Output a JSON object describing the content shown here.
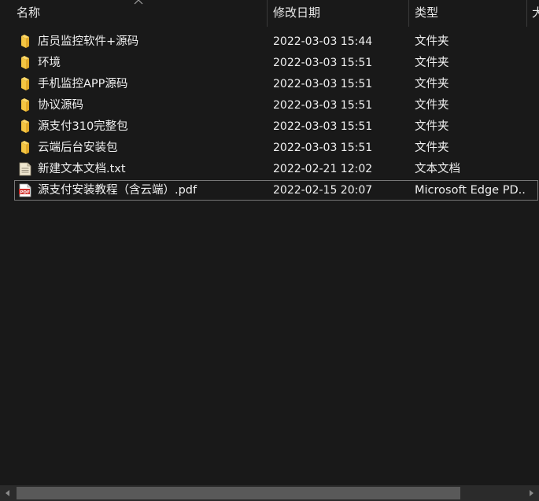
{
  "columns": {
    "name": "名称",
    "date": "修改日期",
    "type": "类型",
    "size": "大"
  },
  "files": [
    {
      "name": "店员监控软件+源码",
      "date": "2022-03-03 15:44",
      "type": "文件夹",
      "icon": "folder-icon"
    },
    {
      "name": "环境",
      "date": "2022-03-03 15:51",
      "type": "文件夹",
      "icon": "folder-icon"
    },
    {
      "name": "手机监控APP源码",
      "date": "2022-03-03 15:51",
      "type": "文件夹",
      "icon": "folder-icon"
    },
    {
      "name": "协议源码",
      "date": "2022-03-03 15:51",
      "type": "文件夹",
      "icon": "folder-icon"
    },
    {
      "name": "源支付310完整包",
      "date": "2022-03-03 15:51",
      "type": "文件夹",
      "icon": "folder-icon"
    },
    {
      "name": "云端后台安装包",
      "date": "2022-03-03 15:51",
      "type": "文件夹",
      "icon": "folder-icon"
    },
    {
      "name": "新建文本文档.txt",
      "date": "2022-02-21 12:02",
      "type": "文本文档",
      "icon": "text-file-icon"
    },
    {
      "name": "源支付安装教程（含云端）.pdf",
      "date": "2022-02-15 20:07",
      "type": "Microsoft Edge PD...",
      "icon": "pdf-file-icon"
    }
  ],
  "selected_index": 7,
  "colors": {
    "background": "#191919",
    "folder": "#f4c542",
    "pdf": "#d1322e"
  }
}
